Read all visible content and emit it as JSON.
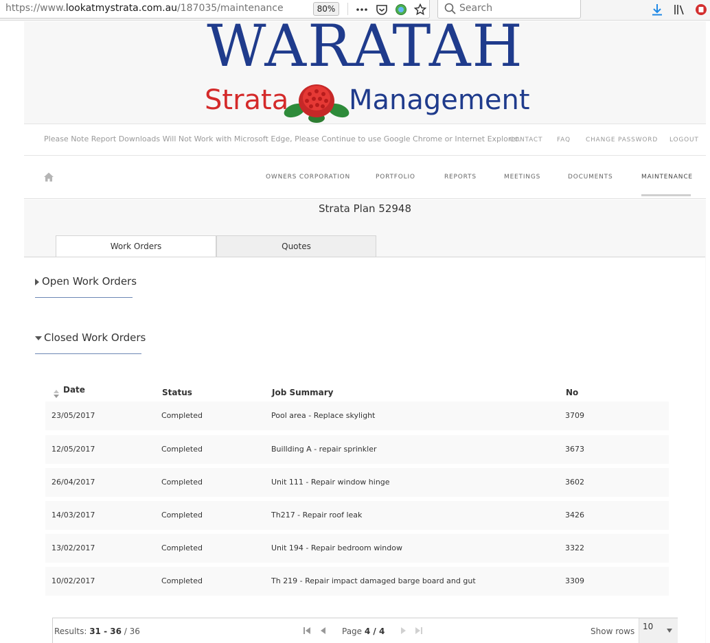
{
  "browser": {
    "url_prefix": "https://www.",
    "url_domain": "lookatmystrata.com.au",
    "url_path": "/187035/maintenance",
    "zoom": "80%",
    "search_placeholder": "Search"
  },
  "brand": {
    "title": "WARATAH",
    "subtitle_left": "Strata",
    "subtitle_right": "Management",
    "blue": "#1f3b8c",
    "red": "#d42a2a"
  },
  "notice": "Please Note Report Downloads Will Not Work with Microsoft Edge, Please Continue to use Google Chrome or Internet Explorer.",
  "top_links": {
    "contact": "CONTACT",
    "faq": "FAQ",
    "change_password": "CHANGE PASSWORD",
    "logout": "LOGOUT"
  },
  "nav": {
    "items": [
      {
        "label": "OWNERS CORPORATION"
      },
      {
        "label": "PORTFOLIO"
      },
      {
        "label": "REPORTS"
      },
      {
        "label": "MEETINGS"
      },
      {
        "label": "DOCUMENTS"
      },
      {
        "label": "MAINTENANCE"
      }
    ],
    "active": "MAINTENANCE"
  },
  "plan_title": "Strata Plan 52948",
  "tabs": {
    "work_orders": "Work Orders",
    "quotes": "Quotes",
    "active": "Work Orders"
  },
  "sections": {
    "open": "Open Work Orders",
    "closed": "Closed Work Orders"
  },
  "table": {
    "headers": {
      "date": "Date",
      "status": "Status",
      "job_summary": "Job Summary",
      "no": "No"
    },
    "rows": [
      {
        "date": "23/05/2017",
        "status": "Completed",
        "summary": "Pool area - Replace skylight",
        "no": "3709"
      },
      {
        "date": "12/05/2017",
        "status": "Completed",
        "summary": "Buillding A - repair sprinkler",
        "no": "3673"
      },
      {
        "date": "26/04/2017",
        "status": "Completed",
        "summary": "Unit 111 - Repair window hinge",
        "no": "3602"
      },
      {
        "date": "14/03/2017",
        "status": "Completed",
        "summary": "Th217 - Repair roof leak",
        "no": "3426"
      },
      {
        "date": "13/02/2017",
        "status": "Completed",
        "summary": "Unit 194 - Repair bedroom window",
        "no": "3322"
      },
      {
        "date": "10/02/2017",
        "status": "Completed",
        "summary": "Th 219 - Repair impact damaged barge board and gut",
        "no": "3309"
      }
    ]
  },
  "pager": {
    "results_label": "Results:",
    "range": "31 - 36",
    "total": "/ 36",
    "page_label": "Page",
    "page_value": "4 / 4",
    "show_rows_label": "Show rows",
    "rows_value": "10"
  }
}
